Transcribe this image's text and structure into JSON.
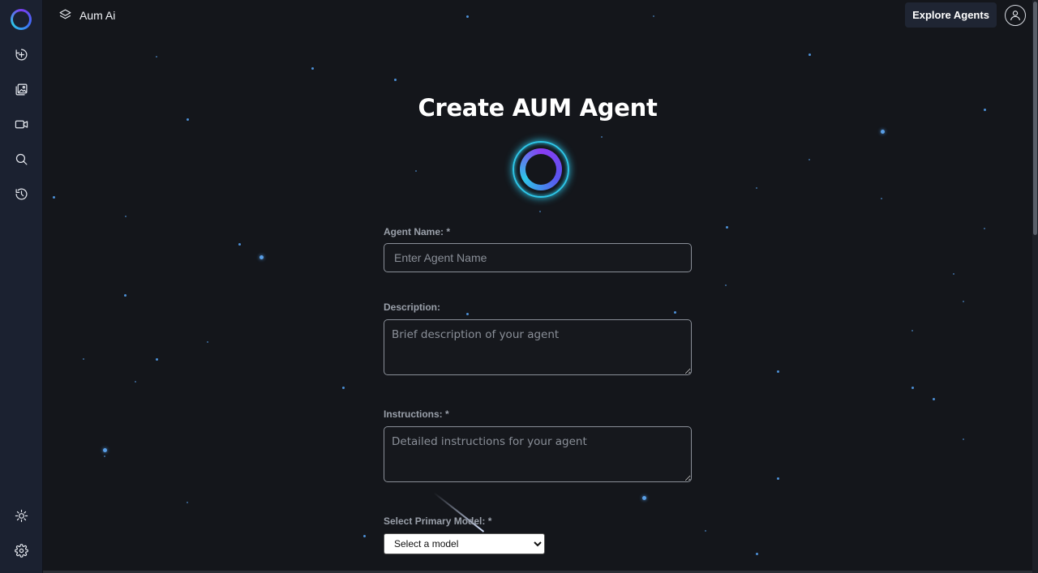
{
  "header": {
    "app_name": "Aum Ai",
    "explore_button": "Explore Agents"
  },
  "sidebar": {
    "items": [
      {
        "name": "logo",
        "icon": "aum-logo-icon"
      },
      {
        "name": "new-chat",
        "icon": "plus-circle-icon"
      },
      {
        "name": "images",
        "icon": "image-gallery-icon"
      },
      {
        "name": "video",
        "icon": "video-camera-icon"
      },
      {
        "name": "search",
        "icon": "search-icon"
      },
      {
        "name": "history",
        "icon": "history-icon"
      },
      {
        "name": "theme",
        "icon": "sun-icon"
      },
      {
        "name": "settings",
        "icon": "gear-icon"
      }
    ]
  },
  "form": {
    "title": "Create AUM Agent",
    "agent_name": {
      "label": "Agent Name: *",
      "placeholder": "Enter Agent Name",
      "value": ""
    },
    "description": {
      "label": "Description:",
      "placeholder": "Brief description of your agent",
      "value": ""
    },
    "instructions": {
      "label": "Instructions: *",
      "placeholder": "Detailed instructions for your agent",
      "value": ""
    },
    "model": {
      "label": "Select Primary Model: *",
      "selected": "Select a model",
      "options": [
        "Select a model"
      ]
    }
  },
  "colors": {
    "sidebar_bg": "#1b2130",
    "page_bg": "#14161b",
    "accent_cyan": "#2ec6e8",
    "accent_purple": "#8a3cf2",
    "star_blue": "#4c8fd6"
  }
}
